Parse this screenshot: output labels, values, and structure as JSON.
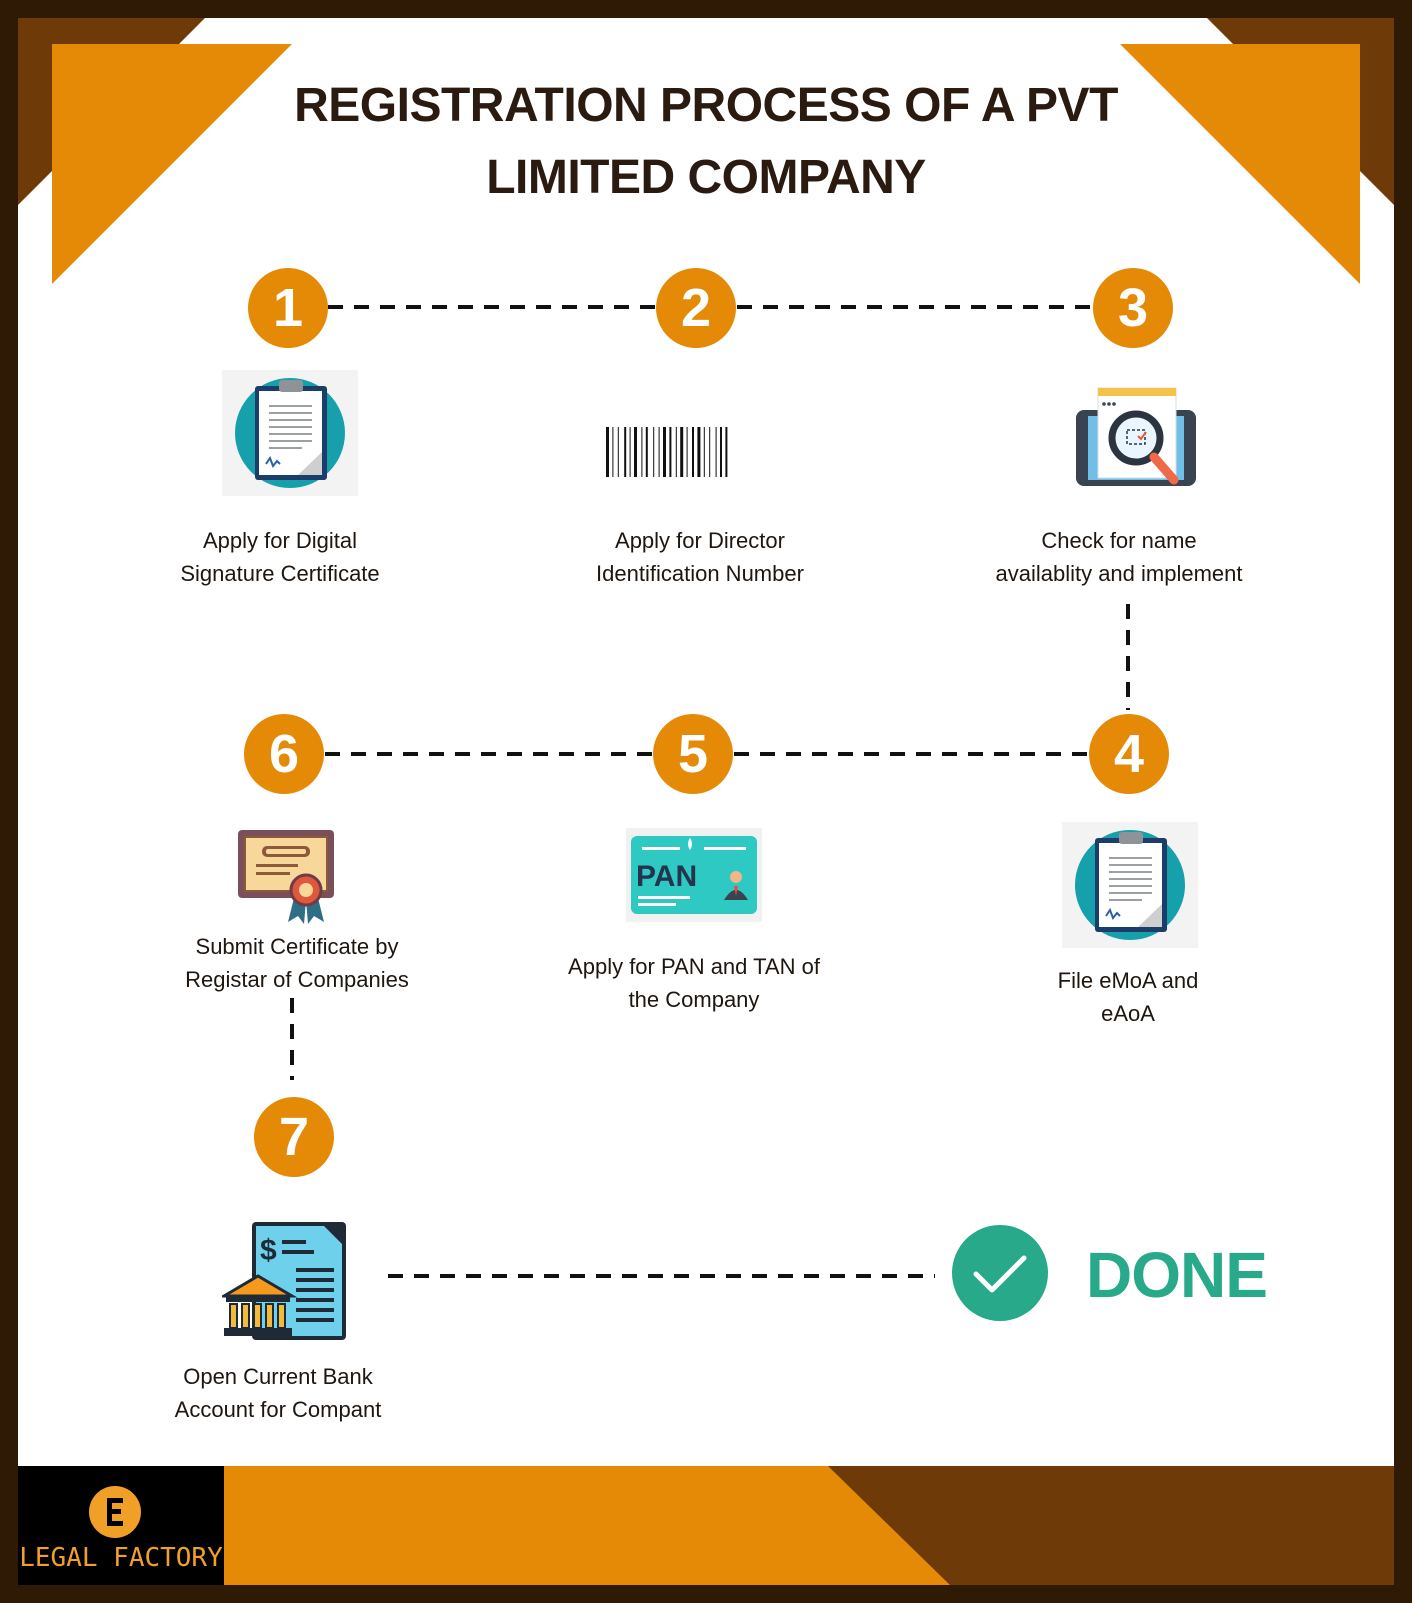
{
  "title": {
    "line1": "REGISTRATION PROCESS OF A PVT",
    "line2": "LIMITED COMPANY"
  },
  "steps": [
    {
      "number": "1",
      "line1": "Apply for Digital",
      "line2": "Signature Certificate",
      "icon": "clipboard-document-icon"
    },
    {
      "number": "2",
      "line1": "Apply for Director",
      "line2": "Identification Number",
      "icon": "barcode-icon"
    },
    {
      "number": "3",
      "line1": "Check for name",
      "line2": "availablity and implement",
      "icon": "tablet-search-icon"
    },
    {
      "number": "4",
      "line1": "File eMoA and",
      "line2": "eAoA",
      "icon": "clipboard-document-icon"
    },
    {
      "number": "5",
      "line1": "Apply for PAN and TAN of",
      "line2": "the Company",
      "icon": "pan-card-icon"
    },
    {
      "number": "6",
      "line1": "Submit Certificate by",
      "line2": "Registar of Companies",
      "icon": "certificate-icon"
    },
    {
      "number": "7",
      "line1": "Open Current Bank",
      "line2": "Account for Compant",
      "icon": "bank-document-icon"
    }
  ],
  "done": {
    "label": "DONE",
    "icon": "checkmark-icon"
  },
  "pan_card_text": "PAN",
  "brand": {
    "name": "LEGAL FACTORY",
    "logo_letter": "E"
  },
  "colors": {
    "accent_orange": "#e48a07",
    "dark_brown": "#6e3a08",
    "frame": "#2e1a05",
    "done_green": "#27a98a",
    "text": "#1f160f"
  }
}
